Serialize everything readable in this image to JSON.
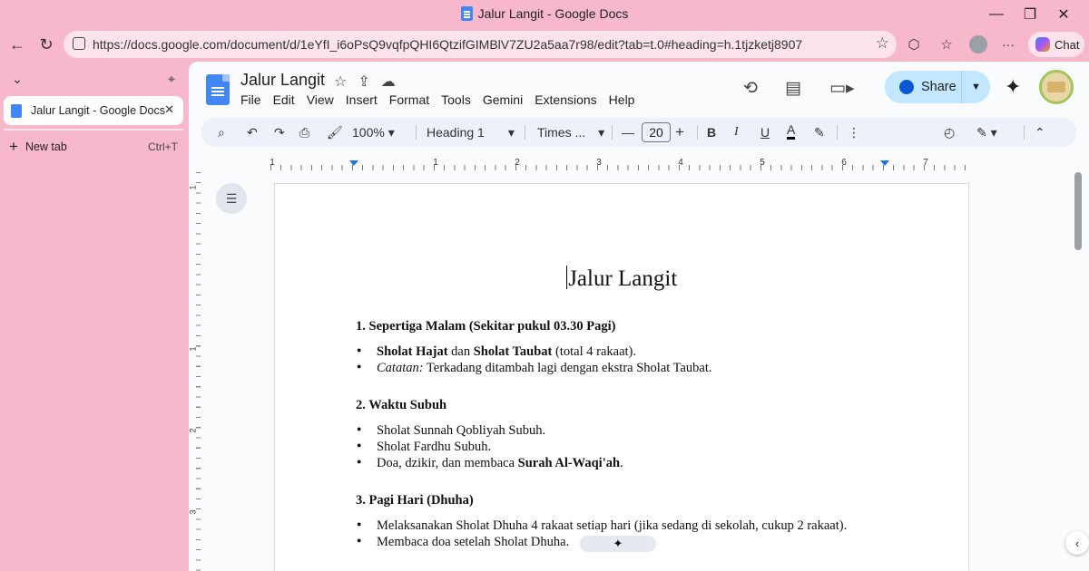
{
  "window": {
    "title": "Jalur Langit - Google Docs",
    "minimize": "—",
    "restore": "❐",
    "close": "✕"
  },
  "nav": {
    "url": "https://docs.google.com/document/d/1eYfI_i6oPsQ9vqfpQHI6QtzifGIMBlV7ZU2a5aa7r98/edit?tab=t.0#heading=h.1tjzketj8907",
    "chat_label": "Chat"
  },
  "sidepanel": {
    "tab_label": "Jalur Langit - Google Docs",
    "new_tab_label": "New tab",
    "new_tab_shortcut": "Ctrl+T"
  },
  "docs": {
    "title": "Jalur Langit",
    "menu": [
      "File",
      "Edit",
      "View",
      "Insert",
      "Format",
      "Tools",
      "Gemini",
      "Extensions",
      "Help"
    ],
    "share_label": "Share",
    "toolbar": {
      "zoom": "100%",
      "style": "Heading 1",
      "font": "Times ...",
      "font_size": "20"
    },
    "ruler_numbers": [
      "1",
      "1",
      "2",
      "3",
      "4",
      "5",
      "6",
      "7"
    ],
    "vruler_numbers": [
      "1",
      "1",
      "2",
      "3"
    ]
  },
  "document": {
    "heading": "Jalur Langit",
    "sections": [
      {
        "title": "1. Sepertiga Malam (Sekitar pukul 03.30 Pagi)"
      },
      {
        "title": "2. Waktu Subuh"
      },
      {
        "title": "3. Pagi Hari (Dhuha)"
      }
    ],
    "s1": {
      "b1_bold1": "Sholat Hajat",
      "b1_mid": " dan ",
      "b1_bold2": "Sholat Taubat",
      "b1_end": " (total 4 rakaat).",
      "b2_italic": "Catatan:",
      "b2_rest": " Terkadang ditambah lagi dengan ekstra Sholat Taubat."
    },
    "s2": {
      "b1": "Sholat Sunnah Qobliyah Subuh.",
      "b2": "Sholat Fardhu Subuh.",
      "b3_start": "Doa, dzikir, dan membaca ",
      "b3_bold": "Surah Al-Waqi'ah",
      "b3_end": "."
    },
    "s3": {
      "b1": "Melaksanakan Sholat Dhuha 4 rakaat setiap hari (jika sedang di sekolah, cukup 2 rakaat).",
      "b2": "Membaca doa setelah Sholat Dhuha."
    }
  },
  "colors": {
    "background": "#f8b8cc",
    "share": "#c2e7ff",
    "toolbar": "#edf2fa",
    "accent": "#1a73e8"
  }
}
